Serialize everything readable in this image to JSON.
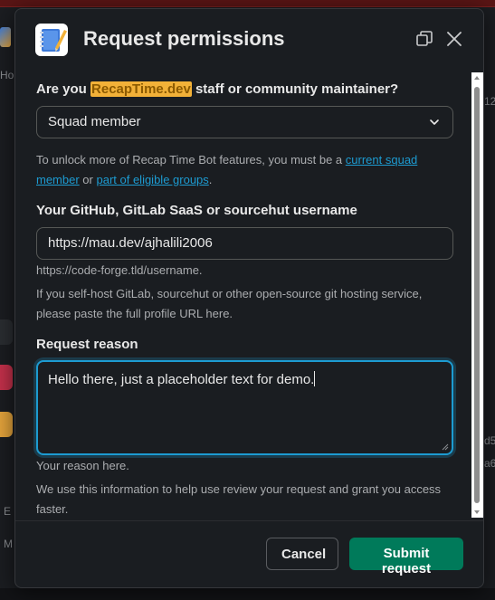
{
  "background": {
    "left_fragments": [
      "Ho",
      "E",
      "M"
    ],
    "right_fragments": [
      "12",
      "d5",
      "a6"
    ]
  },
  "modal": {
    "title": "Request permissions",
    "icons": {
      "app": "notebook-pencil-icon",
      "expand": "expand-window-icon",
      "close": "close-icon"
    },
    "colors": {
      "accent": "#1d9bd1",
      "submit": "#007a5a",
      "highlight": "#f2b138"
    }
  },
  "form": {
    "role": {
      "label_prefix": "Are you ",
      "label_highlight": "RecapTime.dev",
      "label_suffix": " staff or community maintainer?",
      "selected": "Squad member",
      "hint_prefix": "To unlock more of Recap Time Bot features, you must be a ",
      "hint_link1": "current squad member",
      "hint_middle": " or ",
      "hint_link2": "part of eligible groups",
      "hint_suffix": "."
    },
    "username": {
      "label": "Your GitHub, GitLab SaaS or sourcehut username",
      "value": "https://mau.dev/ajhalili2006",
      "hint": "https://code-forge.tld/username.",
      "help": "If you self-host GitLab, sourcehut or other open-source git hosting service, please paste the full profile URL here."
    },
    "reason": {
      "label": "Request reason",
      "value": "Hello there, just a placeholder text for demo.",
      "hint": "Your reason here.",
      "help": "We use this information to help use review your request and grant you access faster."
    }
  },
  "footer": {
    "cancel_label": "Cancel",
    "submit_label": "Submit request"
  }
}
